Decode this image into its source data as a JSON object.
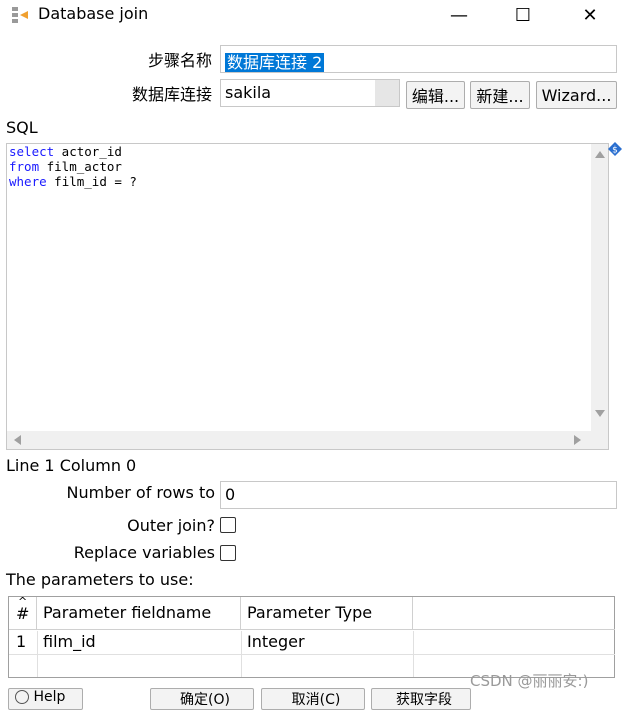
{
  "window": {
    "title": "Database join",
    "minimize": "—",
    "maximize": "☐",
    "close": "✕"
  },
  "step_name": {
    "label": "步骤名称",
    "value": "数据库连接 2"
  },
  "connection": {
    "label": "数据库连接",
    "value": "sakila",
    "edit_button": "编辑...",
    "new_button": "新建...",
    "wizard_button": "Wizard..."
  },
  "sql": {
    "label": "SQL",
    "lines": [
      {
        "kw": "select",
        "rest": " actor_id"
      },
      {
        "kw": "from",
        "rest": " film_actor"
      },
      {
        "kw": "where",
        "rest": " film_id = ?"
      }
    ]
  },
  "status": {
    "position": "Line 1 Column 0"
  },
  "rows": {
    "label": "Number of rows to",
    "value": "0"
  },
  "outer_join": {
    "label": "Outer join?",
    "checked": false
  },
  "replace_vars": {
    "label": "Replace variables",
    "checked": false
  },
  "parameters": {
    "label": "The parameters to use:",
    "columns": [
      "#",
      "Parameter fieldname",
      "Parameter Type"
    ],
    "rows": [
      {
        "num": "1",
        "fieldname": "film_id",
        "type": "Integer"
      }
    ]
  },
  "watermark": "CSDN @丽丽安:)",
  "bottom_buttons": [
    "Help",
    "确定(O)",
    "取消(C)",
    "获取字段"
  ]
}
